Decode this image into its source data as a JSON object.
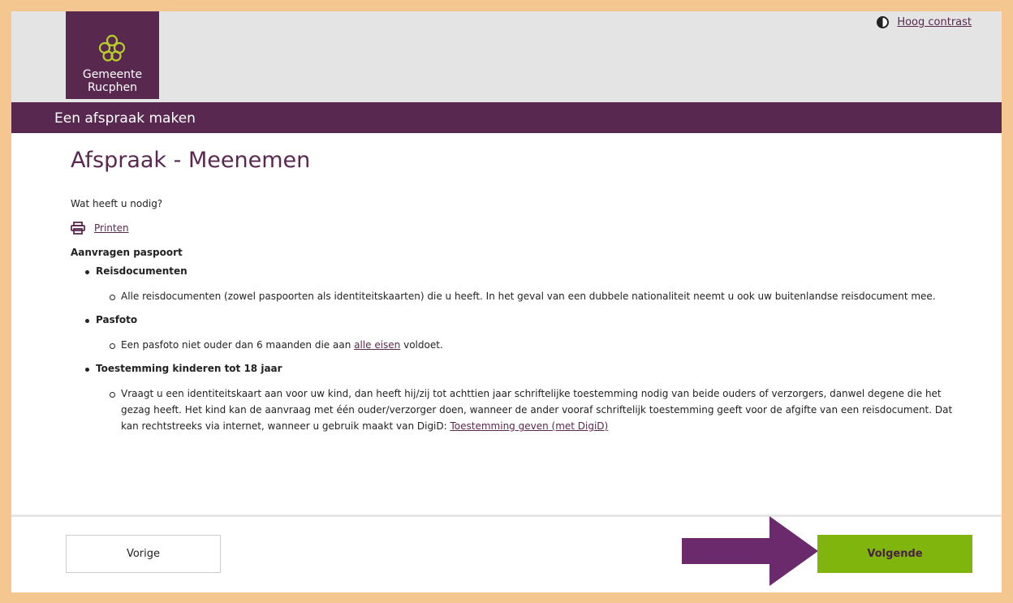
{
  "header": {
    "logo_line1": "Gemeente",
    "logo_line2": "Rucphen",
    "contrast_label": "Hoog contrast"
  },
  "banner": {
    "title": "Een afspraak maken"
  },
  "main": {
    "heading": "Afspraak - Meenemen",
    "question": "Wat heeft u nodig?",
    "print_label": "Printen",
    "section_title": "Aanvragen paspoort",
    "items": [
      {
        "title": "Reisdocumenten",
        "text": "Alle reisdocumenten (zowel paspoorten als identiteitskaarten) die u heeft. In het geval van een dubbele nationaliteit neemt u ook uw buitenlandse reisdocument mee."
      },
      {
        "title": "Pasfoto",
        "text_before": "Een pasfoto niet ouder dan 6 maanden die aan ",
        "link": "alle eisen",
        "text_after": " voldoet."
      },
      {
        "title": "Toestemming kinderen tot 18 jaar",
        "text": "Vraagt u een identiteitskaart aan voor uw kind, dan heeft hij/zij tot achttien jaar schriftelijke toestemming nodig van beide ouders of verzorgers, danwel degene die het gezag heeft. Het kind kan de aanvraag met één ouder/verzorger doen, wanneer de ander vooraf schriftelijk toestemming geeft voor de afgifte van een reisdocument. Dat kan rechtstreeks via internet, wanneer u gebruik maakt van DigiD: ",
        "link": "Toestemming geven (met DigiD)"
      }
    ]
  },
  "footer": {
    "prev_label": "Vorige",
    "next_label": "Volgende"
  },
  "colors": {
    "brand_purple": "#582850",
    "accent_green": "#7fb50c",
    "frame_orange": "#f4c690",
    "annotation_arrow": "#6b2a6b"
  }
}
